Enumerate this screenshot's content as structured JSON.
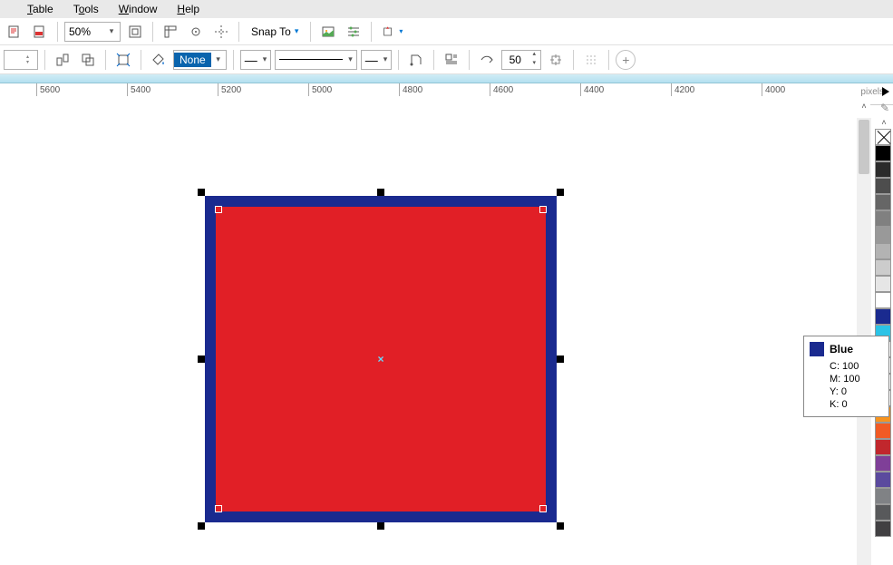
{
  "menu": {
    "table": "Table",
    "tools": "Tools",
    "window": "Window",
    "help": "Help"
  },
  "toolbar1": {
    "zoom": "50%",
    "snapto": "Snap To"
  },
  "toolbar2": {
    "fill": "None",
    "offset": "50"
  },
  "ruler": {
    "ticks": [
      "5600",
      "5400",
      "5200",
      "5000",
      "4800",
      "4600",
      "4400",
      "4200",
      "4000"
    ],
    "units": "pixels"
  },
  "palette": {
    "colors": [
      "#000000",
      "#2b2b2b",
      "#4d4d4d",
      "#666666",
      "#808080",
      "#999999",
      "#b3b3b3",
      "#cccccc",
      "#e6e6e6",
      "#ffffff",
      "#1a2a8f",
      "#2bc3e6",
      "#ffffff",
      "#ffffff",
      "#ffffff",
      "#ffffff",
      "#f7931e",
      "#f15a24",
      "#c1272d",
      "#7f3f98",
      "#5b4a9e",
      "#808285",
      "#58595b",
      "#414042"
    ]
  },
  "tooltip": {
    "name": "Blue",
    "c": "C: 100",
    "m": "M: 100",
    "y": "Y: 0",
    "k": "K: 0"
  }
}
